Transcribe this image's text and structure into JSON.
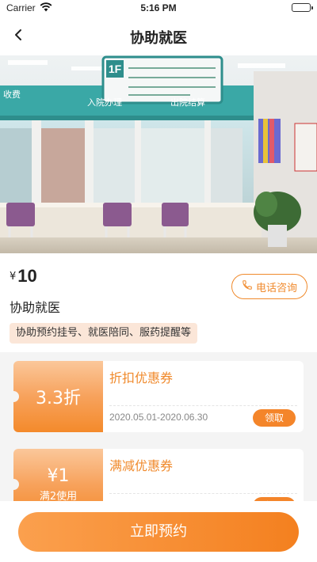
{
  "status_bar": {
    "carrier": "Carrier",
    "time": "5:16 PM"
  },
  "nav": {
    "title": "协助就医"
  },
  "hero": {
    "signs": {
      "floor": "1F",
      "desk_left": "入院办理",
      "desk_right": "出院结算",
      "cashier": "收费"
    }
  },
  "product": {
    "currency": "¥",
    "price": "10",
    "name": "协助就医",
    "call_label": "电话咨询",
    "tag": "协助预约挂号、就医陪同、服药提醒等"
  },
  "coupons": [
    {
      "value": "3.3折",
      "condition": "",
      "title": "折扣优惠券",
      "validity": "2020.05.01-2020.06.30",
      "action": "领取"
    },
    {
      "value": "¥1",
      "condition": "满2使用",
      "title": "满减优惠券",
      "validity": "",
      "action": "领取"
    }
  ],
  "footer": {
    "book_label": "立即预约"
  },
  "colors": {
    "accent": "#f4852a",
    "tag_bg": "#fbe6d8",
    "hero_teal": "#3aa8a6"
  }
}
